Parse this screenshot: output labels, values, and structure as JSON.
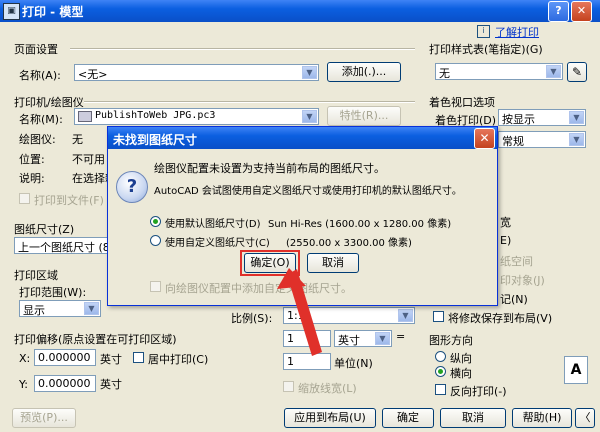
{
  "window": {
    "title": "打印 - 模型",
    "help_btn": "?",
    "close_btn": "✕"
  },
  "info_icon": "i",
  "help_link": "了解打印",
  "page_setup": {
    "group": "页面设置",
    "name_label": "名称(A):",
    "name_value": "<无>",
    "add_button": "添加(.)..."
  },
  "printer": {
    "group": "打印机/绘图仪",
    "name_label": "名称(M):",
    "name_value": "PublishToWeb JPG.pc3",
    "properties_button": "特性(R)...",
    "plotter_label": "绘图仪:",
    "plotter_value": "无",
    "where_label": "位置:",
    "where_value": "不可用",
    "desc_label": "说明:",
    "desc_value": "在选择新",
    "plot_to_file": "打印到文件(F)"
  },
  "paper_size": {
    "group": "图纸尺寸(Z)",
    "value": "上一个图纸尺寸 (8"
  },
  "plot_area": {
    "group": "打印区域",
    "what_label": "打印范围(W):",
    "what_value": "显示"
  },
  "plot_offset": {
    "group": "打印偏移(原点设置在可打印区域)",
    "x_label": "X:",
    "x_value": "0.000000",
    "x_unit": "英寸",
    "y_label": "Y:",
    "y_value": "0.000000",
    "y_unit": "英寸",
    "center": "居中打印(C)"
  },
  "scale": {
    "label": "比例(S):",
    "value": "1:1",
    "num": "1",
    "unit": "英寸",
    "eq": "=",
    "den": "1",
    "den_unit": "单位(N)",
    "lineweights": "缩放线宽(L)"
  },
  "plot_style": {
    "group": "打印样式表(笔指定)(G)",
    "value": "无"
  },
  "shaded": {
    "group": "着色视口选项",
    "shade_label": "着色打印(D)",
    "shade_value": "按显示",
    "quality_value": "常规",
    "frag1": "宽",
    "frag2": "E)",
    "frag3": "纸空间",
    "frag4": "印对象(J)",
    "frag5": "记(N)",
    "save_changes": "将修改保存到布局(V)"
  },
  "orientation": {
    "group": "图形方向",
    "portrait": "纵向",
    "landscape": "横向",
    "upside_down": "反向打印(-)",
    "icon": "A"
  },
  "buttons": {
    "preview": "预览(P)...",
    "apply": "应用到布局(U)",
    "ok": "确定",
    "cancel": "取消",
    "help": "帮助(H)",
    "more": "〈"
  },
  "dialog": {
    "title": "未找到图纸尺寸",
    "close_btn": "✕",
    "icon": "?",
    "line1": "绘图仪配置未设置为支持当前布局的图纸尺寸。",
    "line2": "AutoCAD 会试图使用自定义图纸尺寸或使用打印机的默认图纸尺寸。",
    "opt1_label": "使用默认图纸尺寸(D)",
    "opt1_value": "Sun Hi-Res (1600.00 x 1280.00 像素)",
    "opt2_label": "使用自定义图纸尺寸(C)",
    "opt2_value": "(2550.00 x 3300.00 像素)",
    "ok": "确定(O)",
    "cancel": "取消",
    "add_custom": "向绘图仪配置中添加自定义图纸尺寸。"
  },
  "colors": {
    "highlight": "#e0302a",
    "title_blue": "#0b5fe0"
  }
}
